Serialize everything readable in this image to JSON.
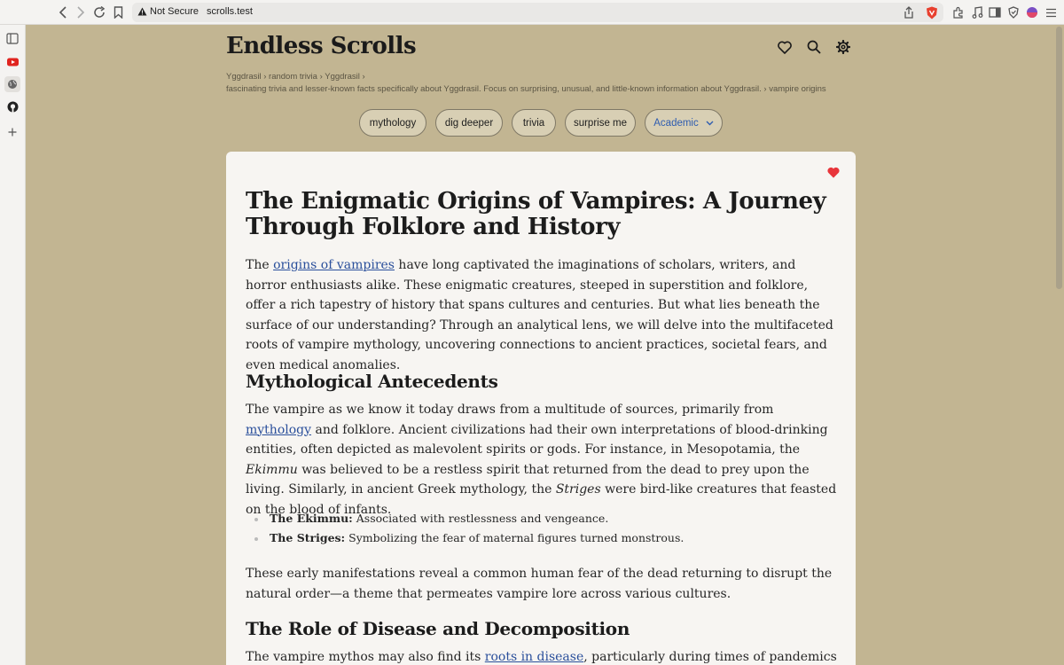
{
  "browser": {
    "security_label": "Not Secure",
    "host": "scrolls.test"
  },
  "site": {
    "title": "Endless Scrolls",
    "breadcrumb_line1": "Yggdrasil › random trivia › Yggdrasil ›",
    "breadcrumb_line2": "fascinating trivia and lesser-known facts specifically about Yggdrasil. Focus on surprising, unusual, and little-known information about Yggdrasil. › vampire origins"
  },
  "chips": [
    {
      "label": "mythology"
    },
    {
      "label": "dig deeper"
    },
    {
      "label": "trivia"
    },
    {
      "label": "surprise me"
    }
  ],
  "style_select": {
    "value": "Academic"
  },
  "article": {
    "title": "The Enigmatic Origins of Vampires: A Journey Through Folklore and History",
    "intro": {
      "before_link": "The ",
      "link": "origins of vampires",
      "after_link": " have long captivated the imaginations of scholars, writers, and horror enthusiasts alike. These enigmatic creatures, steeped in superstition and folklore, offer a rich tapestry of history that spans cultures and centuries. But what lies beneath the surface of our understanding? Through an analytical lens, we will delve into the multifaceted roots of vampire mythology, uncovering connections to ancient practices, societal fears, and even medical anomalies."
    },
    "section1": {
      "heading": "Mythological Antecedents",
      "p_before_link": "The vampire as we know it today draws from a multitude of sources, primarily from ",
      "p_link": "mythology",
      "p_mid1": " and folklore. Ancient civilizations had their own interpretations of blood-drinking entities, often depicted as malevolent spirits or gods. For instance, in Mesopotamia, the ",
      "p_em1": "Ekimmu",
      "p_mid2": " was believed to be a restless spirit that returned from the dead to prey upon the living. Similarly, in ancient Greek mythology, the ",
      "p_em2": "Striges",
      "p_end": " were bird-like creatures that feasted on the blood of infants.",
      "bullets": [
        {
          "term": "The Ekimmu:",
          "desc": " Associated with restlessness and vengeance."
        },
        {
          "term": "The Striges:",
          "desc": " Symbolizing the fear of maternal figures turned monstrous."
        }
      ],
      "closing": "These early manifestations reveal a common human fear of the dead returning to disrupt the natural order—a theme that permeates vampire lore across various cultures."
    },
    "section2": {
      "heading": "The Role of Disease and Decomposition",
      "p_before_link": "The vampire mythos may also find its ",
      "p_link": "roots in disease",
      "p_after_link": ", particularly during times of pandemics and"
    }
  },
  "colors": {
    "page_bg": "#c2b592",
    "card_bg": "#f7f5f2",
    "link": "#2a4f9b",
    "heart": "#e8353b",
    "select_text": "#2e5cb0"
  }
}
